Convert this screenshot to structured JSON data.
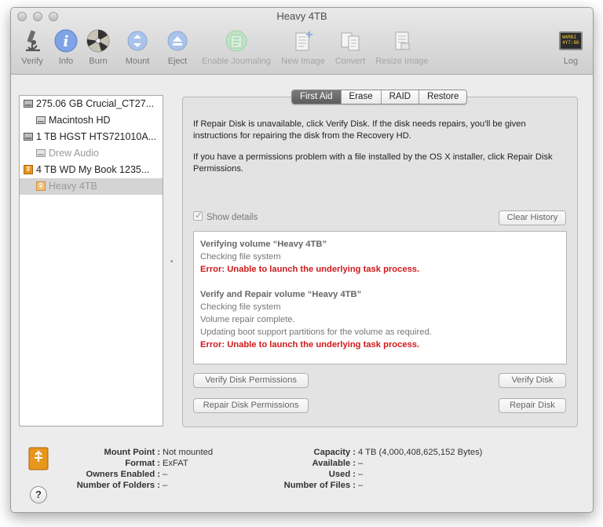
{
  "window": {
    "title": "Heavy 4TB"
  },
  "toolbar": {
    "items": [
      {
        "label": "Verify",
        "icon": "microscope-icon"
      },
      {
        "label": "Info",
        "icon": "info-icon"
      },
      {
        "label": "Burn",
        "icon": "burn-icon"
      },
      {
        "label": "Mount",
        "icon": "mount-icon"
      },
      {
        "label": "Eject",
        "icon": "eject-icon"
      },
      {
        "label": "Enable Journaling",
        "icon": "journaling-icon"
      },
      {
        "label": "New Image",
        "icon": "new-image-icon"
      },
      {
        "label": "Convert",
        "icon": "convert-icon"
      },
      {
        "label": "Resize Image",
        "icon": "resize-image-icon"
      },
      {
        "label": "Log",
        "icon": "log-icon",
        "screen_text": "WARNI\n4Y7:86"
      }
    ]
  },
  "sidebar": {
    "items": [
      {
        "label": "275.06 GB Crucial_CT27...",
        "icon": "internal-disk-icon"
      },
      {
        "label": "Macintosh HD",
        "icon": "volume-icon"
      },
      {
        "label": "1 TB HGST HTS721010A...",
        "icon": "internal-disk-icon"
      },
      {
        "label": "Drew Audio",
        "icon": "volume-icon"
      },
      {
        "label": "4 TB WD My Book 1235...",
        "icon": "external-disk-icon"
      },
      {
        "label": "Heavy 4TB",
        "icon": "external-volume-icon"
      }
    ]
  },
  "tabs": [
    "First Aid",
    "Erase",
    "RAID",
    "Restore"
  ],
  "first_aid": {
    "info1": "If Repair Disk is unavailable, click Verify Disk. If the disk needs repairs, you'll be given instructions for repairing the disk from the Recovery HD.",
    "info2": "If you have a permissions problem with a file installed by the OS X installer, click Repair Disk Permissions.",
    "show_details": "Show details",
    "clear_history": "Clear History",
    "log": [
      {
        "text": "Verifying volume “Heavy 4TB”",
        "kind": "head"
      },
      {
        "text": "Checking file system",
        "kind": "normal"
      },
      {
        "text": "Error: Unable to launch the underlying task process.",
        "kind": "err"
      },
      {
        "text": "Verify and Repair volume “Heavy 4TB”",
        "kind": "head"
      },
      {
        "text": "Checking file system",
        "kind": "normal"
      },
      {
        "text": "Volume repair complete.",
        "kind": "normal"
      },
      {
        "text": "Updating boot support partitions for the volume as required.",
        "kind": "normal"
      },
      {
        "text": "Error: Unable to launch the underlying task process.",
        "kind": "err"
      }
    ],
    "verify_permissions": "Verify Disk Permissions",
    "repair_permissions": "Repair Disk Permissions",
    "verify_disk": "Verify Disk",
    "repair_disk": "Repair Disk"
  },
  "details": {
    "left": [
      {
        "label": "Mount Point :",
        "value": "Not mounted"
      },
      {
        "label": "Format :",
        "value": "ExFAT"
      },
      {
        "label": "Owners Enabled :",
        "value": "–"
      },
      {
        "label": "Number of Folders :",
        "value": "–"
      }
    ],
    "right": [
      {
        "label": "Capacity :",
        "value": "4 TB (4,000,408,625,152 Bytes)"
      },
      {
        "label": "Available :",
        "value": "–"
      },
      {
        "label": "Used :",
        "value": "–"
      },
      {
        "label": "Number of Files :",
        "value": "–"
      }
    ]
  },
  "help": "?",
  "colors": {
    "error": "#d0191b",
    "info_blue": "#3f7fe0",
    "selection": "#d4d4d4",
    "disk_orange": "#e8961c"
  }
}
